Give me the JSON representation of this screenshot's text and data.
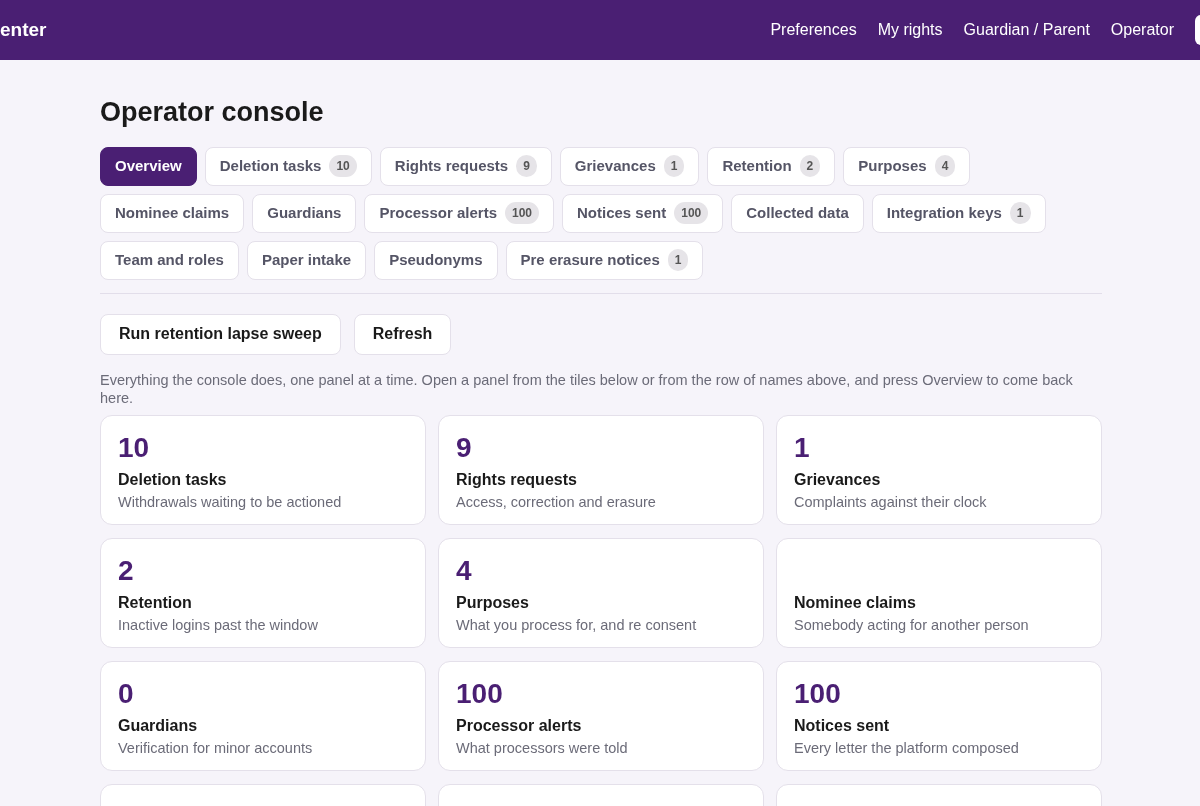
{
  "header": {
    "brand": "enter",
    "nav": [
      {
        "label": "Preferences"
      },
      {
        "label": "My rights"
      },
      {
        "label": "Guardian / Parent"
      },
      {
        "label": "Operator"
      }
    ]
  },
  "title": "Operator console",
  "tabs": [
    {
      "label": "Overview",
      "selected": true
    },
    {
      "label": "Deletion tasks",
      "count": "10",
      "selected": false
    },
    {
      "label": "Rights requests",
      "count": "9",
      "selected": false
    },
    {
      "label": "Grievances",
      "count": "1",
      "selected": false
    },
    {
      "label": "Retention",
      "count": "2",
      "selected": false
    },
    {
      "label": "Purposes",
      "count": "4",
      "selected": false
    },
    {
      "label": "Nominee claims",
      "selected": false
    },
    {
      "label": "Guardians",
      "selected": false
    },
    {
      "label": "Processor alerts",
      "count": "100",
      "selected": false
    },
    {
      "label": "Notices sent",
      "count": "100",
      "selected": false
    },
    {
      "label": "Collected data",
      "selected": false
    },
    {
      "label": "Integration keys",
      "count": "1",
      "selected": false
    },
    {
      "label": "Team and roles",
      "selected": false
    },
    {
      "label": "Paper intake",
      "selected": false
    },
    {
      "label": "Pseudonyms",
      "selected": false
    },
    {
      "label": "Pre erasure notices",
      "count": "1",
      "selected": false
    }
  ],
  "actions": [
    "Run retention lapse sweep",
    "Refresh"
  ],
  "intro": "Everything the console does, one panel at a time. Open a panel from the tiles below or from the row of names above, and press Overview to come back here.",
  "tiles": [
    {
      "count": "10",
      "title": "Deletion tasks",
      "subtitle": "Withdrawals waiting to be actioned"
    },
    {
      "count": "9",
      "title": "Rights requests",
      "subtitle": "Access, correction and erasure"
    },
    {
      "count": "1",
      "title": "Grievances",
      "subtitle": "Complaints against their clock"
    },
    {
      "count": "2",
      "title": "Retention",
      "subtitle": "Inactive logins past the window"
    },
    {
      "count": "4",
      "title": "Purposes",
      "subtitle": "What you process for, and re consent"
    },
    {
      "title": "Nominee claims",
      "subtitle": "Somebody acting for another person"
    },
    {
      "count": "0",
      "title": "Guardians",
      "subtitle": "Verification for minor accounts"
    },
    {
      "count": "100",
      "title": "Processor alerts",
      "subtitle": "What processors were told"
    },
    {
      "count": "100",
      "title": "Notices sent",
      "subtitle": "Every letter the platform composed"
    }
  ]
}
